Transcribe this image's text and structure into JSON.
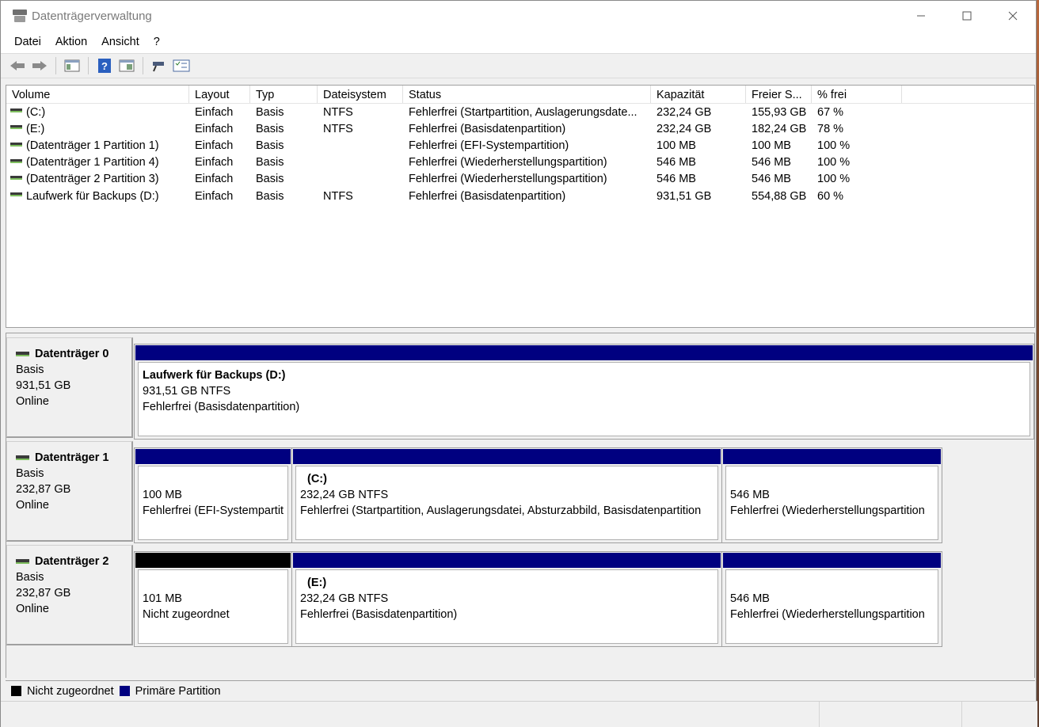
{
  "window": {
    "title": "Datenträgerverwaltung"
  },
  "menu": [
    "Datei",
    "Aktion",
    "Ansicht",
    "?"
  ],
  "toolbar": [
    "back-arrow-icon",
    "forward-arrow-icon",
    "console-tree-icon",
    "help-icon",
    "properties-icon",
    "connect-icon",
    "checklist-icon"
  ],
  "columns": [
    "Volume",
    "Layout",
    "Typ",
    "Dateisystem",
    "Status",
    "Kapazität",
    "Freier S...",
    "% frei"
  ],
  "volumes": [
    [
      "(C:)",
      "Einfach",
      "Basis",
      "NTFS",
      "Fehlerfrei (Startpartition, Auslagerungsdate...",
      "232,24 GB",
      "155,93 GB",
      "67 %"
    ],
    [
      "(E:)",
      "Einfach",
      "Basis",
      "NTFS",
      "Fehlerfrei (Basisdatenpartition)",
      "232,24 GB",
      "182,24 GB",
      "78 %"
    ],
    [
      "(Datenträger 1 Partition 1)",
      "Einfach",
      "Basis",
      "",
      "Fehlerfrei (EFI-Systempartition)",
      "100 MB",
      "100 MB",
      "100 %"
    ],
    [
      "(Datenträger 1 Partition 4)",
      "Einfach",
      "Basis",
      "",
      "Fehlerfrei (Wiederherstellungspartition)",
      "546 MB",
      "546 MB",
      "100 %"
    ],
    [
      "(Datenträger 2 Partition 3)",
      "Einfach",
      "Basis",
      "",
      "Fehlerfrei (Wiederherstellungspartition)",
      "546 MB",
      "546 MB",
      "100 %"
    ],
    [
      "Laufwerk für Backups (D:)",
      "Einfach",
      "Basis",
      "NTFS",
      "Fehlerfrei (Basisdatenpartition)",
      "931,51 GB",
      "554,88 GB",
      "60 %"
    ]
  ],
  "disks": [
    {
      "name": "Datenträger 0",
      "type": "Basis",
      "size": "931,51 GB",
      "state": "Online",
      "partitions": [
        {
          "title": "Laufwerk für Backups  (D:)",
          "line1": "931,51 GB NTFS",
          "line2": "Fehlerfrei (Basisdatenpartition)",
          "bar": "blue"
        }
      ]
    },
    {
      "name": "Datenträger 1",
      "type": "Basis",
      "size": "232,87 GB",
      "state": "Online",
      "partitions": [
        {
          "title": "",
          "line1": "100 MB",
          "line2": "Fehlerfrei (EFI-Systempartit",
          "bar": "blue"
        },
        {
          "title": "(C:)",
          "line1": "232,24 GB NTFS",
          "line2": "Fehlerfrei (Startpartition, Auslagerungsdatei, Absturzabbild, Basisdatenpartition",
          "bar": "blue"
        },
        {
          "title": "",
          "line1": "546 MB",
          "line2": "Fehlerfrei (Wiederherstellungspartition",
          "bar": "blue"
        }
      ]
    },
    {
      "name": "Datenträger 2",
      "type": "Basis",
      "size": "232,87 GB",
      "state": "Online",
      "partitions": [
        {
          "title": "",
          "line1": "101 MB",
          "line2": "Nicht zugeordnet",
          "bar": "black"
        },
        {
          "title": "(E:)",
          "line1": "232,24 GB NTFS",
          "line2": "Fehlerfrei (Basisdatenpartition)",
          "bar": "blue"
        },
        {
          "title": "",
          "line1": "546 MB",
          "line2": "Fehlerfrei (Wiederherstellungspartition",
          "bar": "blue"
        }
      ]
    }
  ],
  "legend": [
    {
      "label": "Nicht zugeordnet",
      "color": "#000000"
    },
    {
      "label": "Primäre Partition",
      "color": "#000080"
    }
  ]
}
